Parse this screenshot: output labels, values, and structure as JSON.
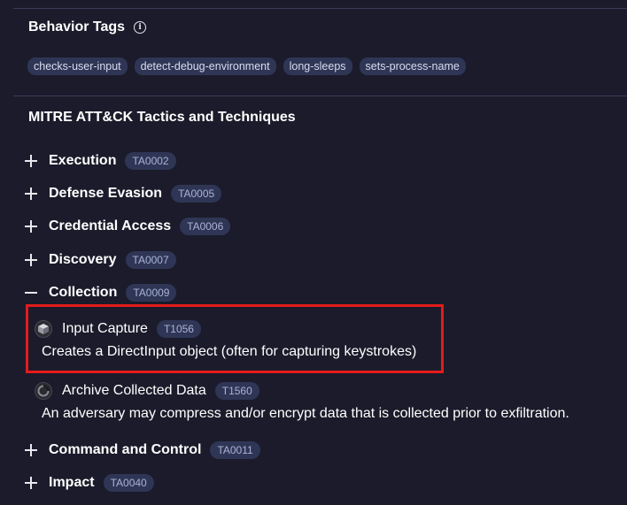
{
  "behavior_tags": {
    "title": "Behavior Tags",
    "info_glyph": "i",
    "tags": [
      "checks-user-input",
      "detect-debug-environment",
      "long-sleeps",
      "sets-process-name"
    ]
  },
  "mitre": {
    "title": "MITRE ATT&CK Tactics and Techniques",
    "tactics": [
      {
        "name": "Execution",
        "id": "TA0002",
        "expanded": false
      },
      {
        "name": "Defense Evasion",
        "id": "TA0005",
        "expanded": false
      },
      {
        "name": "Credential Access",
        "id": "TA0006",
        "expanded": false
      },
      {
        "name": "Discovery",
        "id": "TA0007",
        "expanded": false
      },
      {
        "name": "Collection",
        "id": "TA0009",
        "expanded": true,
        "techniques": [
          {
            "name": "Input Capture",
            "id": "T1056",
            "icon": "cube-icon",
            "description": "Creates a DirectInput object (often for capturing keystrokes)"
          },
          {
            "name": "Archive Collected Data",
            "id": "T1560",
            "icon": "archive-icon",
            "description": "An adversary may compress and/or encrypt data that is collected prior to exfiltration."
          }
        ]
      },
      {
        "name": "Command and Control",
        "id": "TA0011",
        "expanded": false
      },
      {
        "name": "Impact",
        "id": "TA0040",
        "expanded": false
      }
    ]
  },
  "colors": {
    "background": "#1b1b2b",
    "badge_bg": "#2f3655",
    "badge_text": "#aab3d6",
    "highlight_border": "#e31b1b"
  }
}
